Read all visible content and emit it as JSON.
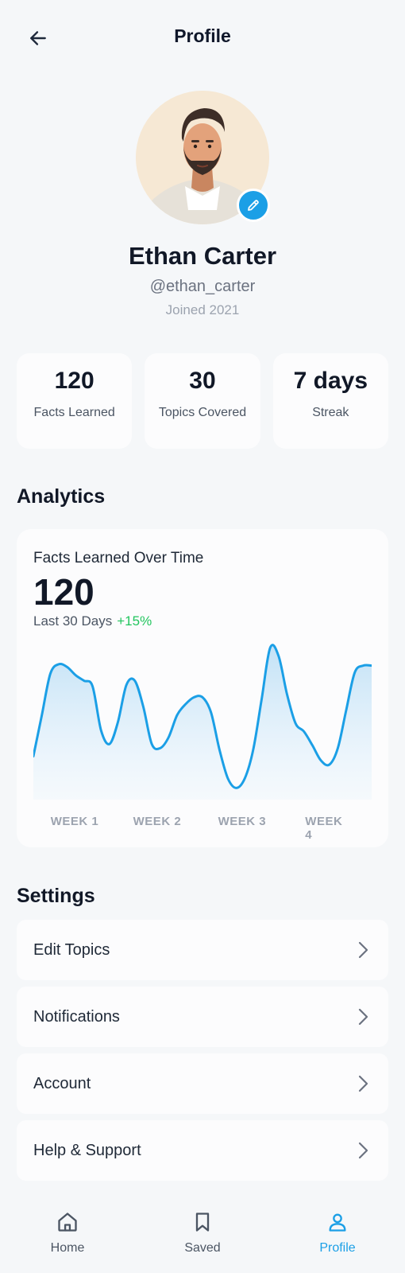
{
  "header": {
    "title": "Profile"
  },
  "profile": {
    "name": "Ethan Carter",
    "handle": "@ethan_carter",
    "joined": "Joined 2021"
  },
  "stats": [
    {
      "value": "120",
      "label": "Facts Learned"
    },
    {
      "value": "30",
      "label": "Topics Covered"
    },
    {
      "value": "7 days",
      "label": "Streak"
    }
  ],
  "analytics": {
    "section_title": "Analytics",
    "card_title": "Facts Learned Over Time",
    "value": "120",
    "period": "Last 30 Days",
    "change": "+15%"
  },
  "chart_data": {
    "type": "area",
    "x_labels": [
      "WEEK 1",
      "WEEK 2",
      "WEEK 3",
      "WEEK 4"
    ],
    "x": [
      0,
      0.5,
      1,
      1.5,
      2,
      2.5,
      3,
      3.5,
      4,
      4.5,
      5,
      5.5,
      6,
      6.5,
      7,
      7.5,
      8,
      8.5,
      9,
      9.5,
      10,
      10.5,
      11,
      11.5,
      12,
      12.5,
      13,
      13.5,
      14,
      14.5,
      15,
      15.5,
      16,
      16.5,
      17,
      17.5,
      18,
      18.5,
      19,
      19.5,
      20
    ],
    "values": [
      28,
      58,
      88,
      95,
      93,
      87,
      83,
      79,
      47,
      37,
      53,
      80,
      83,
      64,
      37,
      34,
      42,
      58,
      66,
      71,
      71,
      60,
      33,
      12,
      5,
      12,
      33,
      70,
      107,
      101,
      73,
      52,
      46,
      36,
      25,
      22,
      34,
      62,
      89,
      94,
      94
    ],
    "ylim": [
      0,
      110
    ],
    "line_color": "#1b9fe6",
    "fill_color": "#cfe8f8",
    "grid": false,
    "legend": "none"
  },
  "settings": {
    "section_title": "Settings",
    "items": [
      {
        "label": "Edit Topics"
      },
      {
        "label": "Notifications"
      },
      {
        "label": "Account"
      },
      {
        "label": "Help & Support"
      }
    ]
  },
  "nav": [
    {
      "label": "Home",
      "icon": "home-icon"
    },
    {
      "label": "Saved",
      "icon": "bookmark-icon"
    },
    {
      "label": "Profile",
      "icon": "user-icon",
      "active": true
    }
  ],
  "colors": {
    "accent": "#1b9fe6",
    "positive": "#22c55e",
    "background": "#f5f7f9",
    "card": "#fcfcfd"
  }
}
